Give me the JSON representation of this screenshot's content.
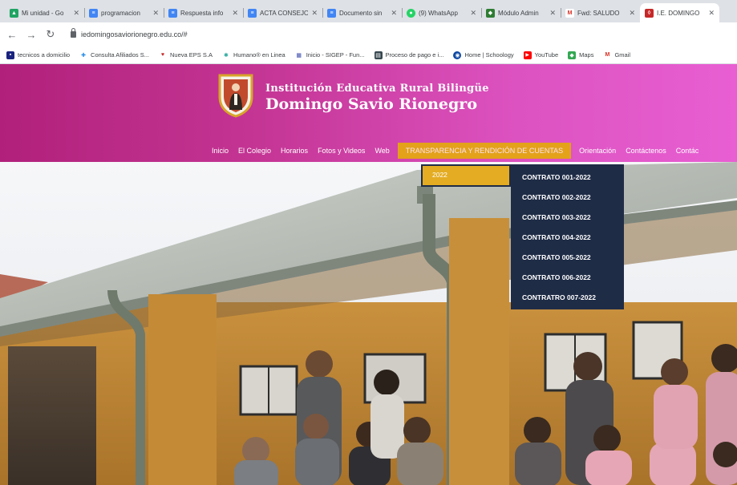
{
  "browser": {
    "tabs": [
      {
        "title": "Mi unidad - Go",
        "icon": "google-drive-icon",
        "color": "#1fa463"
      },
      {
        "title": "programacion",
        "icon": "docs-icon",
        "color": "#4285f4"
      },
      {
        "title": "Respuesta info",
        "icon": "docs-icon",
        "color": "#4285f4"
      },
      {
        "title": "ACTA CONSEJO",
        "icon": "docs-icon",
        "color": "#4285f4"
      },
      {
        "title": "Documento sin",
        "icon": "docs-icon",
        "color": "#4285f4"
      },
      {
        "title": "(9) WhatsApp",
        "icon": "whatsapp-icon",
        "color": "#25d366"
      },
      {
        "title": "Módulo Admin",
        "icon": "module-icon",
        "color": "#2e7d32"
      },
      {
        "title": "Fwd: SALUDO",
        "icon": "gmail-icon",
        "color": "#d93025"
      },
      {
        "title": "I.E. DOMINGO",
        "icon": "school-crest-icon",
        "color": "#c62828"
      }
    ],
    "url": "iedomingosaviorionegro.edu.co/#",
    "bookmarks": [
      {
        "label": "tecnicos a domicilio",
        "icon": "bookmark-icon",
        "color": "#1a237e"
      },
      {
        "label": "Consulta Afiliados S...",
        "icon": "cross-icon",
        "color": "#1e88e5"
      },
      {
        "label": "Nueva EPS S.A",
        "icon": "heart-icon",
        "color": "#c62828"
      },
      {
        "label": "Humano® en Linea",
        "icon": "person-icon",
        "color": "#26a69a"
      },
      {
        "label": "Inicio - SIGEP - Fun...",
        "icon": "grid-icon",
        "color": "#3949ab"
      },
      {
        "label": "Proceso de pago e i...",
        "icon": "doc-icon",
        "color": "#37474f"
      },
      {
        "label": "Home | Schoology",
        "icon": "globe-icon",
        "color": "#0d47a1"
      },
      {
        "label": "YouTube",
        "icon": "youtube-icon",
        "color": "#ff0000"
      },
      {
        "label": "Maps",
        "icon": "maps-icon",
        "color": "#34a853"
      },
      {
        "label": "Gmail",
        "icon": "gmail-icon",
        "color": "#d93025"
      }
    ]
  },
  "site": {
    "name_line1": "Institución Educativa Rural Bilingüe",
    "name_line2": "Domingo Savio Rionegro",
    "nav": [
      "Inicio",
      "El Colegio",
      "Horarios",
      "Fotos y Videos",
      "Web",
      "TRANSPARENCIA Y RENDICIÓN DE CUENTAS",
      "Orientación",
      "Contáctenos",
      "Contác"
    ],
    "menu_year": "2022",
    "contracts": [
      "CONTRATO 001-2022",
      "CONTRATO 002-2022",
      "CONTRATO 003-2022",
      "CONTRATO 004-2022",
      "CONTRATO 005-2022",
      "CONTRATO 006-2022",
      "CONTRATRO 007-2022"
    ],
    "colors": {
      "header_start": "#b1217b",
      "header_end": "#e85fd3",
      "menu_highlight": "#e3a21a",
      "dropdown_bg": "#1f2c46"
    }
  }
}
